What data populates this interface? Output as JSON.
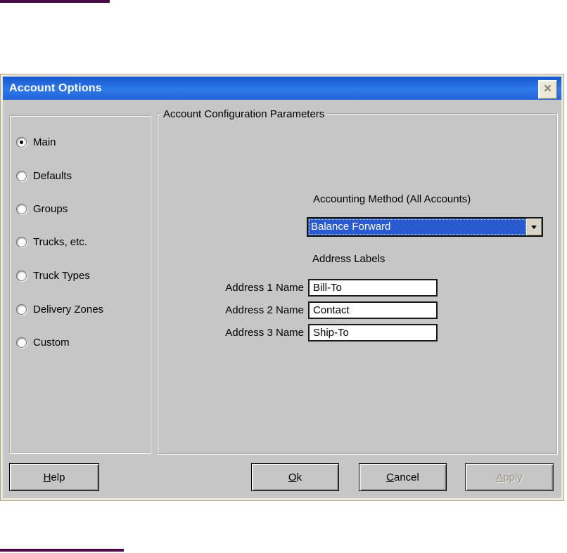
{
  "window": {
    "title": "Account Options",
    "close_icon": "×"
  },
  "sidebar": {
    "items": [
      {
        "label": "Main",
        "selected": true
      },
      {
        "label": "Defaults",
        "selected": false
      },
      {
        "label": "Groups",
        "selected": false
      },
      {
        "label": "Trucks, etc.",
        "selected": false
      },
      {
        "label": "Truck Types",
        "selected": false
      },
      {
        "label": "Delivery Zones",
        "selected": false
      },
      {
        "label": "Custom",
        "selected": false
      }
    ]
  },
  "panel": {
    "group_title": "Account Configuration Parameters",
    "accounting_method": {
      "label": "Accounting Method (All Accounts)",
      "value": "Balance Forward"
    },
    "address_labels": {
      "heading": "Address Labels",
      "rows": [
        {
          "label": "Address 1 Name",
          "value": "Bill-To"
        },
        {
          "label": "Address 2 Name",
          "value": "Contact"
        },
        {
          "label": "Address 3 Name",
          "value": "Ship-To"
        }
      ]
    }
  },
  "buttons": {
    "help": {
      "key": "H",
      "rest": "elp",
      "enabled": true
    },
    "ok": {
      "key": "O",
      "rest": "k",
      "enabled": true
    },
    "cancel": {
      "key": "C",
      "rest": "ancel",
      "enabled": true
    },
    "apply": {
      "key": "A",
      "rest": "pply",
      "enabled": false
    }
  },
  "colors": {
    "titlebar_blue": "#2468df",
    "selection_blue": "#2a5ad0",
    "dialog_frame_beige": "#ece9d8",
    "dialog_body_gray": "#c6c6c6",
    "background_artifact_purple": "#470a45"
  }
}
